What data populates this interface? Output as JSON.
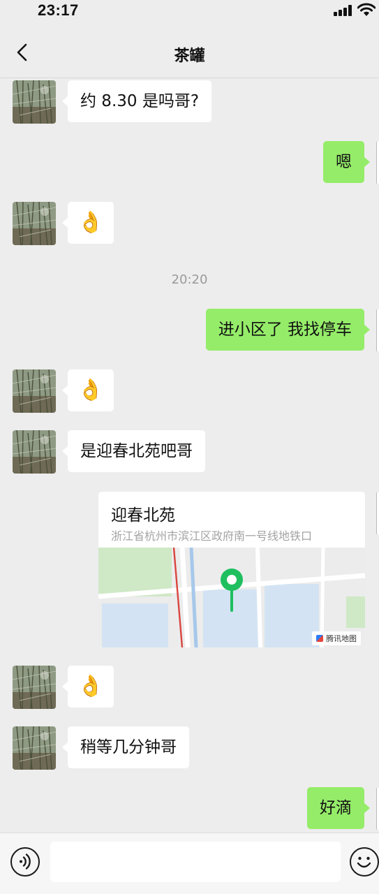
{
  "status_bar": {
    "time": "23:17"
  },
  "header": {
    "title": "茶罐"
  },
  "messages": [
    {
      "text": "约 8.30 是吗哥?"
    },
    {
      "text": "嗯"
    },
    {
      "text": "👌"
    },
    {
      "text": "20:20"
    },
    {
      "text": "进小区了 我找停车"
    },
    {
      "text": "👌"
    },
    {
      "text": "是迎春北苑吧哥"
    },
    {
      "title": "迎春北苑",
      "address": "浙江省杭州市滨江区政府南一号线地铁口",
      "map_provider": "腾讯地图"
    },
    {
      "text": "👌"
    },
    {
      "text": "稍等几分钟哥"
    },
    {
      "text": "好滴"
    }
  ],
  "input_bar": {
    "voice_icon": "voice-icon",
    "emoji_icon": "emoji-icon"
  }
}
